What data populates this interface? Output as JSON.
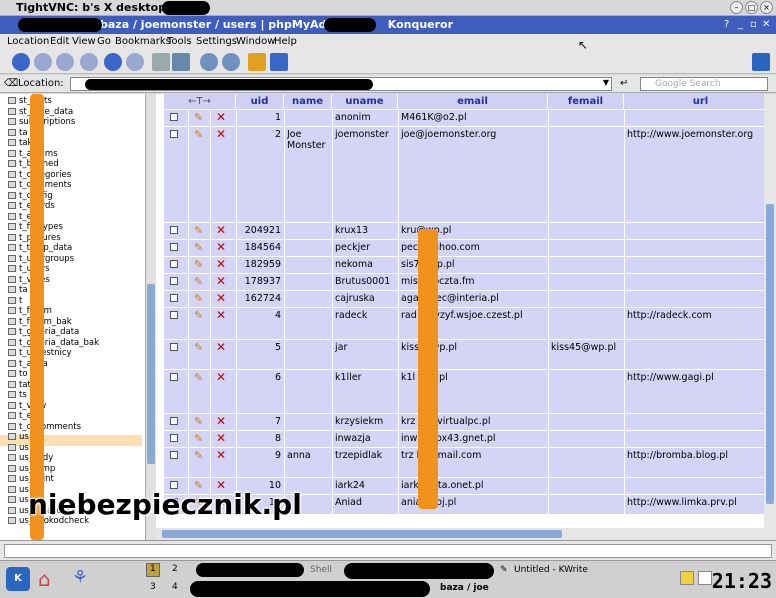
{
  "vnc_title": "TightVNC: b's X desktop",
  "konq_title": "baza / joemonster / users | phpMyAdmin          Konqueror",
  "menu": [
    "Location",
    "Edit",
    "View",
    "Go",
    "Bookmarks",
    "Tools",
    "Settings",
    "Window",
    "Help"
  ],
  "location_label": "Location:",
  "search_placeholder": "Google Search",
  "tables": [
    "st_stats",
    "st_vote_data",
    "subscriptions",
    "ta",
    "tak",
    "t_albums",
    "t_banned",
    "t_categories",
    "t_comments",
    "t_config",
    "t_ecards",
    "t_exif",
    "t_filetypes",
    "t_pictures",
    "t_temp_data",
    "t_usergroups",
    "t_users",
    "t_votes",
    "ta",
    "t",
    "t_forum",
    "t_forum_bak",
    "t_galeria_data",
    "t_galeria_data_bak",
    "t_uczestnicy",
    "t_agda",
    "to",
    "tats",
    "ts",
    "t_view",
    "t_er",
    "t_d_comments",
    "us",
    "us",
    "us_kody",
    "us_temp",
    "us_zaint",
    "us",
    "us",
    "us_data_old",
    "us_imokodcheck"
  ],
  "columns": [
    "uid",
    "name",
    "uname",
    "email",
    "femail",
    "url"
  ],
  "arrows": "←T→",
  "rows": [
    {
      "uid": "1",
      "name": "",
      "uname": "anonim",
      "email": "M461K@o2.pl",
      "femail": "",
      "url": ""
    },
    {
      "uid": "2",
      "name": "Joe Monster",
      "uname": "joemonster",
      "email": "joe@joemonster.org",
      "femail": "",
      "url": "http://www.joemonster.org"
    },
    {
      "uid": "204921",
      "name": "",
      "uname": "krux13",
      "email": "kru@wp.pl",
      "femail": "",
      "url": ""
    },
    {
      "uid": "184564",
      "name": "",
      "uname": "peckjer",
      "email": "pec@yahoo.com",
      "femail": "",
      "url": ""
    },
    {
      "uid": "182959",
      "name": "",
      "uname": "nekoma",
      "email": "sis7@wp.pl",
      "femail": "",
      "url": ""
    },
    {
      "uid": "178937",
      "name": "",
      "uname": "Brutus0001",
      "email": "mis@poczta.fm",
      "femail": "",
      "url": ""
    },
    {
      "uid": "162724",
      "name": "",
      "uname": "cajruska",
      "email": "aga ypiec@interia.pl",
      "femail": "",
      "url": ""
    },
    {
      "uid": "4",
      "name": "",
      "uname": "radeck",
      "email": "rad @syzyf.wsjoe.czest.pl",
      "femail": "",
      "url": "http://radeck.com"
    },
    {
      "uid": "5",
      "name": "",
      "uname": "jar",
      "email": "kiss @wp.pl",
      "femail": "kiss45@wp.pl",
      "url": ""
    },
    {
      "uid": "6",
      "name": "",
      "uname": "k1ller",
      "email": "k1l go2.pl",
      "femail": "",
      "url": "http://www.gagi.pl"
    },
    {
      "uid": "7",
      "name": "",
      "uname": "krzysiekm",
      "email": "krz m@virtualpc.pl",
      "femail": "",
      "url": ""
    },
    {
      "uid": "8",
      "name": "",
      "uname": "inwazja",
      "email": "inw @box43.gnet.pl",
      "femail": "",
      "url": ""
    },
    {
      "uid": "9",
      "name": "anna",
      "uname": "trzepidlak",
      "email": "trz k@gmail.com",
      "femail": "",
      "url": "http://bromba.blog.pl"
    },
    {
      "uid": "10",
      "name": "",
      "uname": "iark24",
      "email": "iark oczta.onet.pl",
      "femail": "",
      "url": ""
    },
    {
      "uid": "11",
      "name": "",
      "uname": "Aniad",
      "email": "ania ahoj.pl",
      "femail": "",
      "url": "http://www.limka.prv.pl"
    }
  ],
  "watermark": "niebezpiecznik.pl",
  "taskbar": {
    "desk1": "1",
    "desk2": "2",
    "desk3": "3",
    "desk4": "4",
    "shell": "Shell",
    "kwrite": "Untitled - KWrite",
    "baza": "baza / joe",
    "clock": "21:23"
  }
}
